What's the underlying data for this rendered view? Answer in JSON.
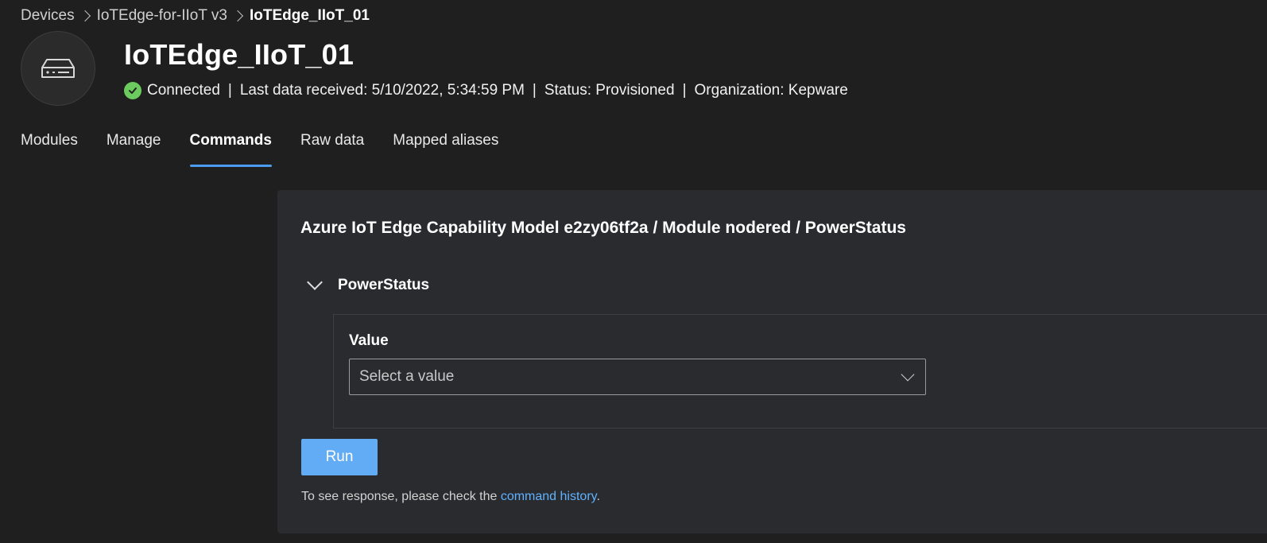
{
  "breadcrumb": {
    "items": [
      "Devices",
      "IoTEdge-for-IIoT v3",
      "IoTEdge_IIoT_01"
    ]
  },
  "device": {
    "icon": "gateway-device-icon",
    "title": "IoTEdge_IIoT_01",
    "connection_status": "Connected",
    "last_data": "Last data received: 5/10/2022, 5:34:59 PM",
    "status": "Status: Provisioned",
    "organization": "Organization: Kepware",
    "separator": "|"
  },
  "tabs": [
    {
      "label": "Modules",
      "active": false
    },
    {
      "label": "Manage",
      "active": false
    },
    {
      "label": "Commands",
      "active": true
    },
    {
      "label": "Raw data",
      "active": false
    },
    {
      "label": "Mapped aliases",
      "active": false
    }
  ],
  "command": {
    "title": "Azure IoT Edge Capability Model e2zy06tf2a / Module nodered / PowerStatus",
    "section_label": "PowerStatus",
    "field_label": "Value",
    "select_placeholder": "Select a value",
    "run_label": "Run",
    "hint_prefix": "To see response, please check the ",
    "hint_link": "command history",
    "hint_suffix": "."
  },
  "colors": {
    "background": "#201f1f",
    "card": "#292b2e",
    "accent": "#4c9df0",
    "run_button": "#62abf5",
    "link": "#5fb2ff",
    "connected": "#6ccb5f"
  }
}
